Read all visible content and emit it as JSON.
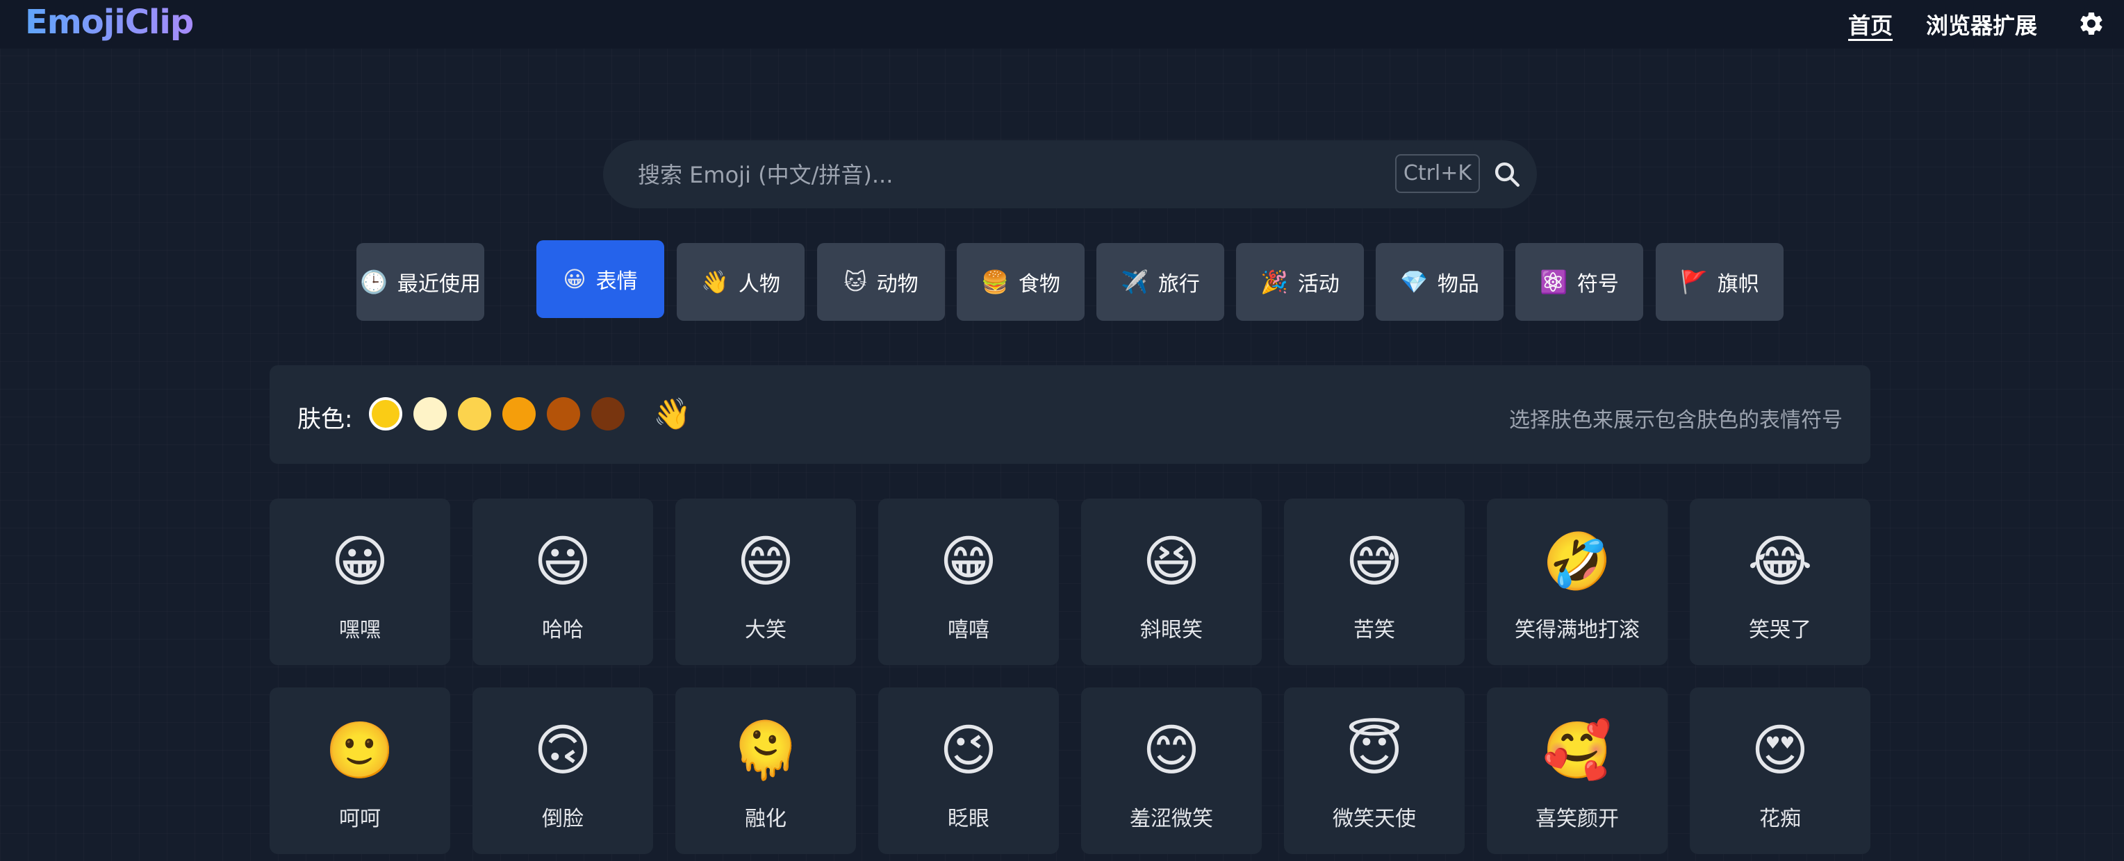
{
  "header": {
    "logo": "EmojiClip",
    "nav": {
      "home": "首页",
      "extension": "浏览器扩展"
    },
    "theme_icon": "gear-icon"
  },
  "search": {
    "placeholder": "搜索 Emoji (中文/拼音)...",
    "value": "",
    "shortcut": "Ctrl+K",
    "icon": "search-icon"
  },
  "categories": [
    {
      "icon": "🕒",
      "label": "最近使用",
      "active": false
    },
    {
      "icon": "😀",
      "label": "表情",
      "active": true
    },
    {
      "icon": "👋",
      "label": "人物",
      "active": false
    },
    {
      "icon": "🐱",
      "label": "动物",
      "active": false
    },
    {
      "icon": "🍔",
      "label": "食物",
      "active": false
    },
    {
      "icon": "✈️",
      "label": "旅行",
      "active": false
    },
    {
      "icon": "🎉",
      "label": "活动",
      "active": false
    },
    {
      "icon": "💎",
      "label": "物品",
      "active": false
    },
    {
      "icon": "⚛️",
      "label": "符号",
      "active": false
    },
    {
      "icon": "🚩",
      "label": "旗帜",
      "active": false
    }
  ],
  "skin_tone": {
    "label": "肤色:",
    "tones": [
      "#facc15",
      "#fef3c7",
      "#fcd34d",
      "#f59e0b",
      "#b45309",
      "#78350f"
    ],
    "selected": 0,
    "preview": "👋",
    "hint": "选择肤色来展示包含肤色的表情符号"
  },
  "emojis": [
    {
      "char": "😀",
      "name": "嘿嘿"
    },
    {
      "char": "😃",
      "name": "哈哈"
    },
    {
      "char": "😄",
      "name": "大笑"
    },
    {
      "char": "😁",
      "name": "嘻嘻"
    },
    {
      "char": "😆",
      "name": "斜眼笑"
    },
    {
      "char": "😅",
      "name": "苦笑"
    },
    {
      "char": "🤣",
      "name": "笑得满地打滚"
    },
    {
      "char": "😂",
      "name": "笑哭了"
    },
    {
      "char": "🙂",
      "name": "呵呵"
    },
    {
      "char": "🙃",
      "name": "倒脸"
    },
    {
      "char": "🫠",
      "name": "融化"
    },
    {
      "char": "😉",
      "name": "眨眼"
    },
    {
      "char": "😊",
      "name": "羞涩微笑"
    },
    {
      "char": "😇",
      "name": "微笑天使"
    },
    {
      "char": "🥰",
      "name": "喜笑颜开"
    },
    {
      "char": "😍",
      "name": "花痴"
    }
  ]
}
